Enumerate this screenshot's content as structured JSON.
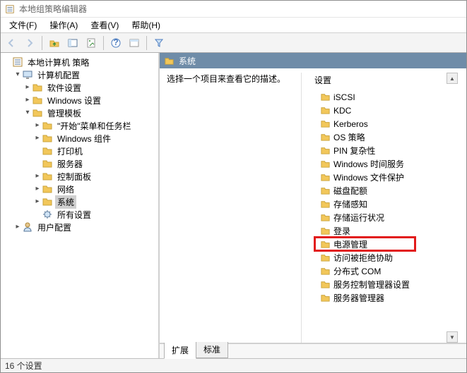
{
  "window_title": "本地组策略编辑器",
  "menus": {
    "file": "文件(F)",
    "action": "操作(A)",
    "view": "查看(V)",
    "help": "帮助(H)"
  },
  "tree": {
    "root": "本地计算机 策略",
    "computer_config": "计算机配置",
    "software_settings": "软件设置",
    "windows_settings": "Windows 设置",
    "admin_templates": "管理模板",
    "start_menu": "\"开始\"菜单和任务栏",
    "windows_components": "Windows 组件",
    "printers": "打印机",
    "server": "服务器",
    "control_panel": "控制面板",
    "network": "网络",
    "system": "系统",
    "all_settings": "所有设置",
    "user_config": "用户配置"
  },
  "header_title": "系统",
  "description_prompt": "选择一个项目来查看它的描述。",
  "column_header": "设置",
  "items": [
    "iSCSI",
    "KDC",
    "Kerberos",
    "OS 策略",
    "PIN 复杂性",
    "Windows 时间服务",
    "Windows 文件保护",
    "磁盘配额",
    "存储感知",
    "存储运行状况",
    "登录",
    "电源管理",
    "访问被拒绝协助",
    "分布式 COM",
    "服务控制管理器设置",
    "服务器管理器"
  ],
  "tabs": {
    "extended": "扩展",
    "standard": "标准"
  },
  "status": "16 个设置"
}
